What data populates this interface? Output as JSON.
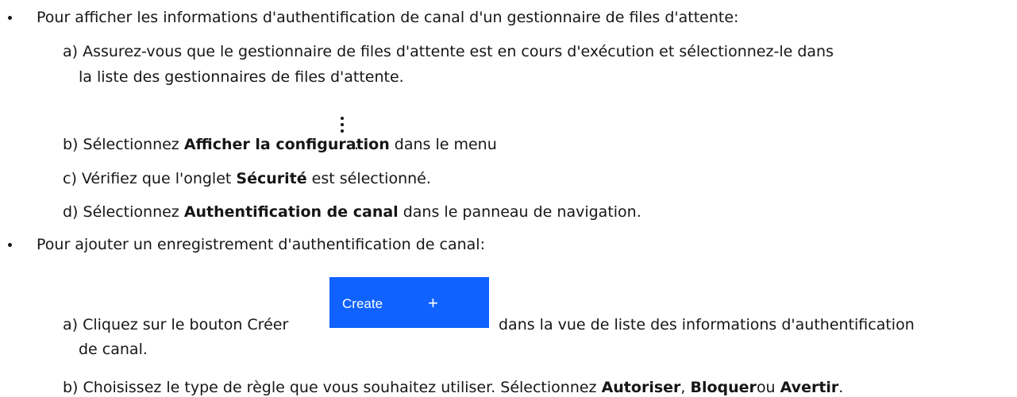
{
  "section1": {
    "bullet_text": "Pour afficher les informations d'authentification de canal d'un gestionnaire de files d'attente:",
    "step_a_line1": "a) Assurez-vous que le gestionnaire de files d'attente est en cours d'exécution et sélectionnez-le dans",
    "step_a_line2": "la liste des gestionnaires de files d'attente.",
    "step_b": {
      "pre": "b) Sélectionnez ",
      "bold": "Afficher la configuration",
      "post": " dans le menu",
      "end": "."
    },
    "step_b_icon": "overflow-menu-vertical-icon",
    "step_c": {
      "pre": "c) Vérifiez que l'onglet ",
      "bold": "Sécurité",
      "post": " est sélectionné."
    },
    "step_d": {
      "pre": "d) Sélectionnez ",
      "bold": "Authentification de canal",
      "post": " dans le panneau de navigation."
    }
  },
  "section2": {
    "bullet_text": "Pour ajouter un enregistrement d'authentification de canal:",
    "step_a": {
      "pre": "a) Cliquez sur le bouton Créer",
      "post": "dans la vue de liste des informations d'authentification",
      "line2": "de canal."
    },
    "create_button": {
      "label": "Create",
      "icon": "+",
      "color": "#0f62fe"
    },
    "step_b": {
      "pre": "b) Choisissez le type de règle que vous souhaitez utiliser. Sélectionnez ",
      "bold1": "Autoriser",
      "sep1": ", ",
      "bold2": "Bloquer",
      "sep2": "ou ",
      "bold3": "Avertir",
      "end": "."
    }
  }
}
